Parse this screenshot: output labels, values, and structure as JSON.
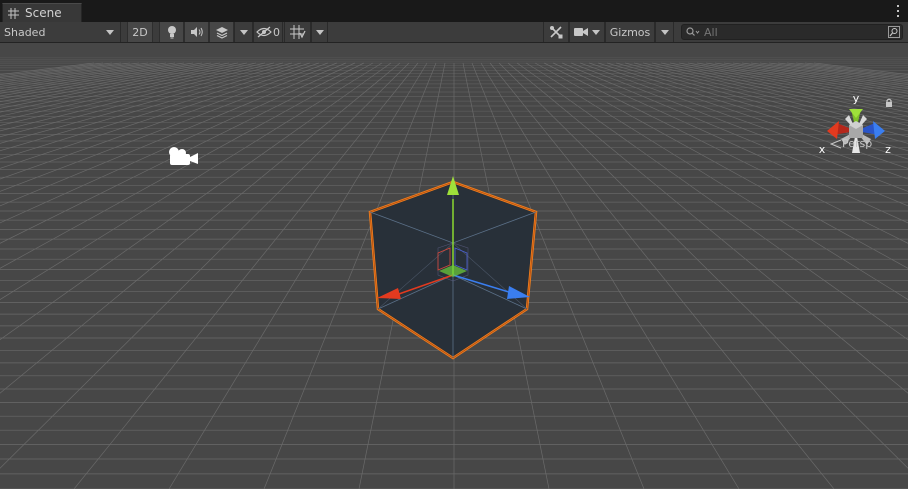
{
  "tab": {
    "title": "Scene"
  },
  "toolbar": {
    "draw_mode": "Shaded",
    "mode_2d": "2D",
    "hidden_count": "0",
    "gizmos": "Gizmos",
    "search_placeholder": "All"
  },
  "scene": {
    "projection": "Persp",
    "axes": {
      "x": "x",
      "y": "y",
      "z": "z"
    }
  },
  "colors": {
    "background": "#474747",
    "grid": "#6a6a6a",
    "selection_outline": "#f07f1e",
    "x_axis": "#e23a1f",
    "y_axis": "#8ad830",
    "z_axis": "#3a7ef0"
  }
}
